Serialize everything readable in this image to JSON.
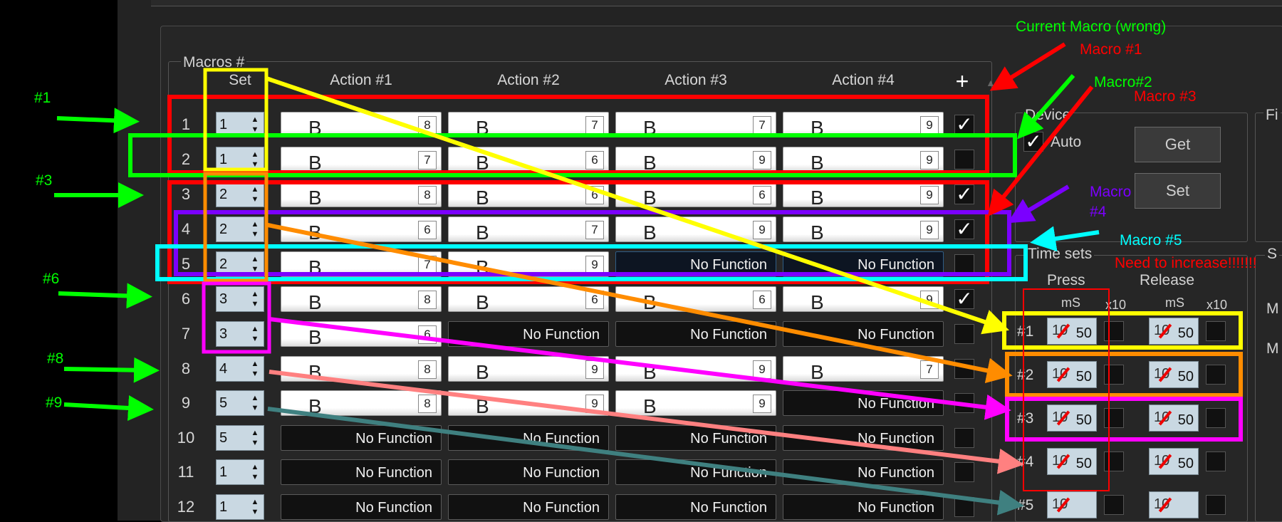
{
  "macros_group": {
    "title": "Macros #",
    "headers": {
      "set": "Set",
      "a1": "Action #1",
      "a2": "Action #2",
      "a3": "Action #3",
      "a4": "Action #4",
      "add": "+"
    },
    "rows": [
      {
        "num": "1",
        "set": "1",
        "actions": [
          {
            "k": "B",
            "n": "8"
          },
          {
            "k": "B",
            "n": "7"
          },
          {
            "k": "B",
            "n": "7"
          },
          {
            "k": "B",
            "n": "9"
          }
        ],
        "checked": true
      },
      {
        "num": "2",
        "set": "1",
        "actions": [
          {
            "k": "B",
            "n": "7"
          },
          {
            "k": "B",
            "n": "6"
          },
          {
            "k": "B",
            "n": "9"
          },
          {
            "k": "B",
            "n": "9"
          }
        ],
        "checked": false
      },
      {
        "num": "3",
        "set": "2",
        "actions": [
          {
            "k": "B",
            "n": "8"
          },
          {
            "k": "B",
            "n": "6"
          },
          {
            "k": "B",
            "n": "6"
          },
          {
            "k": "B",
            "n": "9"
          }
        ],
        "checked": true
      },
      {
        "num": "4",
        "set": "2",
        "actions": [
          {
            "k": "B",
            "n": "6"
          },
          {
            "k": "B",
            "n": "7"
          },
          {
            "k": "B",
            "n": "9"
          },
          {
            "k": "B",
            "n": "9"
          }
        ],
        "checked": true
      },
      {
        "num": "5",
        "set": "2",
        "actions": [
          {
            "k": "B",
            "n": "7"
          },
          {
            "k": "B",
            "n": "9"
          },
          {
            "nf": "No Function"
          },
          {
            "nf": "No Function"
          }
        ],
        "checked": false
      },
      {
        "num": "6",
        "set": "3",
        "actions": [
          {
            "k": "B",
            "n": "8"
          },
          {
            "k": "B",
            "n": "6"
          },
          {
            "k": "B",
            "n": "6"
          },
          {
            "k": "B",
            "n": "9"
          }
        ],
        "checked": true
      },
      {
        "num": "7",
        "set": "3",
        "actions": [
          {
            "k": "B",
            "n": "6"
          },
          {
            "nf": "No Function"
          },
          {
            "nf": "No Function"
          },
          {
            "nf": "No Function"
          }
        ],
        "checked": false
      },
      {
        "num": "8",
        "set": "4",
        "actions": [
          {
            "k": "B",
            "n": "8"
          },
          {
            "k": "B",
            "n": "9"
          },
          {
            "k": "B",
            "n": "9"
          },
          {
            "k": "B",
            "n": "7"
          }
        ],
        "checked": false
      },
      {
        "num": "9",
        "set": "5",
        "actions": [
          {
            "k": "B",
            "n": "8"
          },
          {
            "k": "B",
            "n": "9"
          },
          {
            "k": "B",
            "n": "9"
          },
          {
            "nf": "No Function"
          }
        ],
        "checked": false
      },
      {
        "num": "10",
        "set": "5",
        "actions": [
          {
            "nf": "No Function"
          },
          {
            "nf": "No Function"
          },
          {
            "nf": "No Function"
          },
          {
            "nf": "No Function"
          }
        ],
        "checked": false
      },
      {
        "num": "11",
        "set": "1",
        "actions": [
          {
            "nf": "No Function"
          },
          {
            "nf": "No Function"
          },
          {
            "nf": "No Function"
          },
          {
            "nf": "No Function"
          }
        ],
        "checked": false
      },
      {
        "num": "12",
        "set": "1",
        "actions": [
          {
            "nf": "No Function"
          },
          {
            "nf": "No Function"
          },
          {
            "nf": "No Function"
          },
          {
            "nf": "No Function"
          }
        ],
        "checked": false
      }
    ]
  },
  "device_group": {
    "title": "Device",
    "auto_label": "Auto",
    "auto_checked": true,
    "get_label": "Get",
    "set_label": "Set",
    "right_title": "Fi"
  },
  "time_sets": {
    "title": "Time sets",
    "press": "Press",
    "release": "Release",
    "ms": "mS",
    "x10": "x10",
    "right_title": "S",
    "right_m1": "M",
    "right_m2": "M",
    "rows": [
      {
        "label": "#1",
        "press_old": "10",
        "press": "50",
        "release_old": "10",
        "release": "50"
      },
      {
        "label": "#2",
        "press_old": "10",
        "press": "50",
        "release_old": "10",
        "release": "50"
      },
      {
        "label": "#3",
        "press_old": "10",
        "press": "50",
        "release_old": "10",
        "release": "50"
      },
      {
        "label": "#4",
        "press_old": "10",
        "press": "50",
        "release_old": "10",
        "release": "50"
      },
      {
        "label": "#5",
        "press_old": "10",
        "press": "",
        "release_old": "10",
        "release": ""
      }
    ]
  },
  "annotations": {
    "current_macro": "Current Macro (wrong)",
    "macro1": "Macro #1",
    "macro2": "Macro#2",
    "macro3": "Macro #3",
    "macro4a": "Macro",
    "macro4b": "#4",
    "macro5": "Macro #5",
    "need_increase": "Need to increase!!!!!!!",
    "left_1": "#1",
    "left_3": "#3",
    "left_6": "#6",
    "left_8": "#8",
    "left_9": "#9"
  },
  "colors": {
    "red": "#ff0000",
    "green": "#00ff00",
    "yellow": "#ffff00",
    "orange": "#ff8c00",
    "purple": "#7b00ff",
    "cyan": "#00ffff",
    "magenta": "#ff00ff",
    "pink": "#ff8080",
    "teal": "#3f8080"
  }
}
